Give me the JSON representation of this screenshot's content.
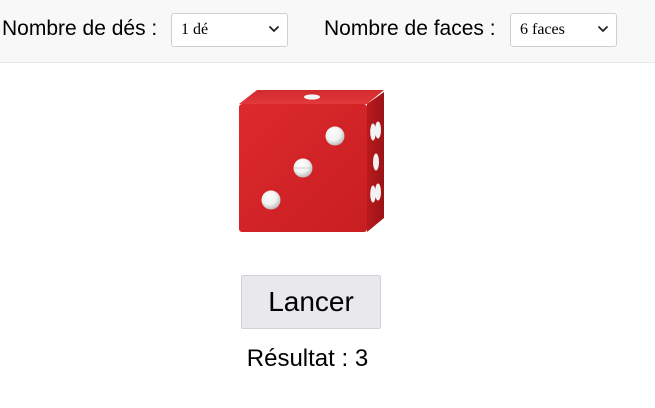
{
  "toolbar": {
    "dice_count_label": "Nombre de dés :",
    "dice_count_value": "1 dé",
    "faces_label": "Nombre de faces :",
    "faces_value": "6 faces"
  },
  "die": {
    "color": "#d42427",
    "front_face_value": 3
  },
  "roll_button_label": "Lancer",
  "result": {
    "label": "Résultat :",
    "value": "3"
  }
}
